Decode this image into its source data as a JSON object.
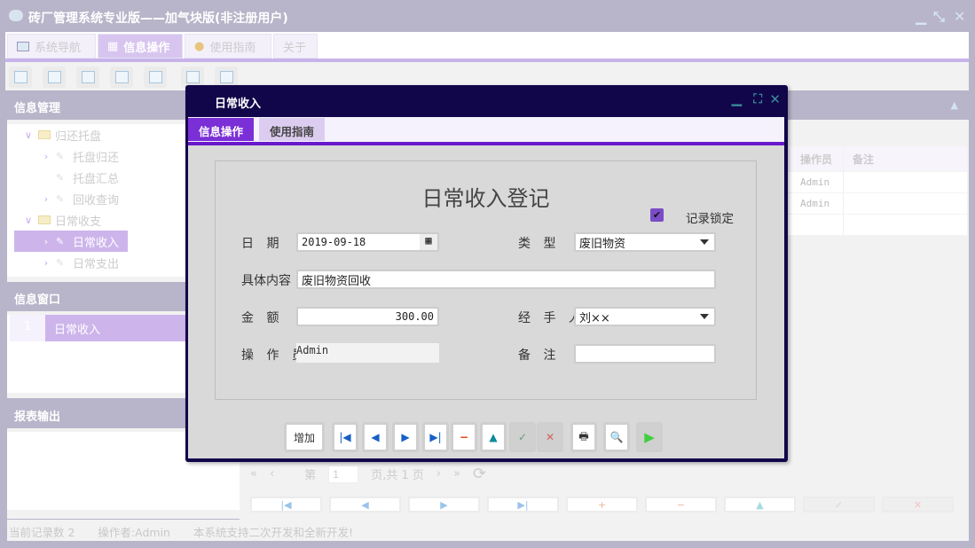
{
  "app": {
    "title": "砖厂管理系统专业版——加气块版(非注册用户)"
  },
  "main_tabs": [
    {
      "label": "系统导航"
    },
    {
      "label": "信息操作"
    },
    {
      "label": "使用指南"
    },
    {
      "label": "关于"
    }
  ],
  "left": {
    "info_mgmt": "信息管理",
    "tree": [
      {
        "label": "归还托盘",
        "type": "folder"
      },
      {
        "label": "托盘归还"
      },
      {
        "label": "托盘汇总"
      },
      {
        "label": "回收查询"
      },
      {
        "label": "日常收支",
        "type": "folder"
      },
      {
        "label": "日常收入",
        "selected": true
      },
      {
        "label": "日常支出"
      }
    ],
    "info_window": "信息窗口",
    "windows": [
      {
        "index": "1",
        "label": "日常收入"
      }
    ],
    "report": "报表输出"
  },
  "grid": {
    "headers": [
      "操作员",
      "备注"
    ],
    "rows": [
      [
        "Admin",
        ""
      ],
      [
        "Admin",
        ""
      ]
    ]
  },
  "pager": {
    "first": "«",
    "prev": "‹",
    "page_prefix": "第",
    "page": "1",
    "page_suffix": "页,共 1 页",
    "next": "›",
    "last": "»",
    "refresh": "⟳"
  },
  "nav_buttons": [
    "|◀",
    "◀",
    "▶",
    "▶|",
    "+",
    "−",
    "▲",
    "✓",
    "✕"
  ],
  "status": {
    "records": "当前记录数 2",
    "operator": "操作者:Admin",
    "note": "本系统支持二次开发和全新开发!"
  },
  "dialog": {
    "title": "日常收入",
    "tabs": [
      "信息操作",
      "使用指南"
    ],
    "heading": "日常收入登记",
    "lock_label": "记录锁定",
    "locked": true,
    "fields": {
      "date_label": "日 期",
      "date": "2019-09-18",
      "type_label": "类 型",
      "type": "废旧物资",
      "content_label": "具体内容",
      "content": "废旧物资回收",
      "amount_label": "金 额",
      "amount": "300.00",
      "handler_label": "经 手 人",
      "handler": "刘××",
      "operator_label": "操 作 员",
      "operator": "Admin",
      "remark_label": "备 注",
      "remark": ""
    },
    "buttons": {
      "add": "增加",
      "first": "|◀",
      "prev": "◀",
      "next": "▶",
      "last": "▶|",
      "delete": "−",
      "up": "▲",
      "confirm": "✓",
      "cancel": "✕",
      "print": "🖶",
      "preview": "🔍",
      "run": "▶"
    }
  }
}
